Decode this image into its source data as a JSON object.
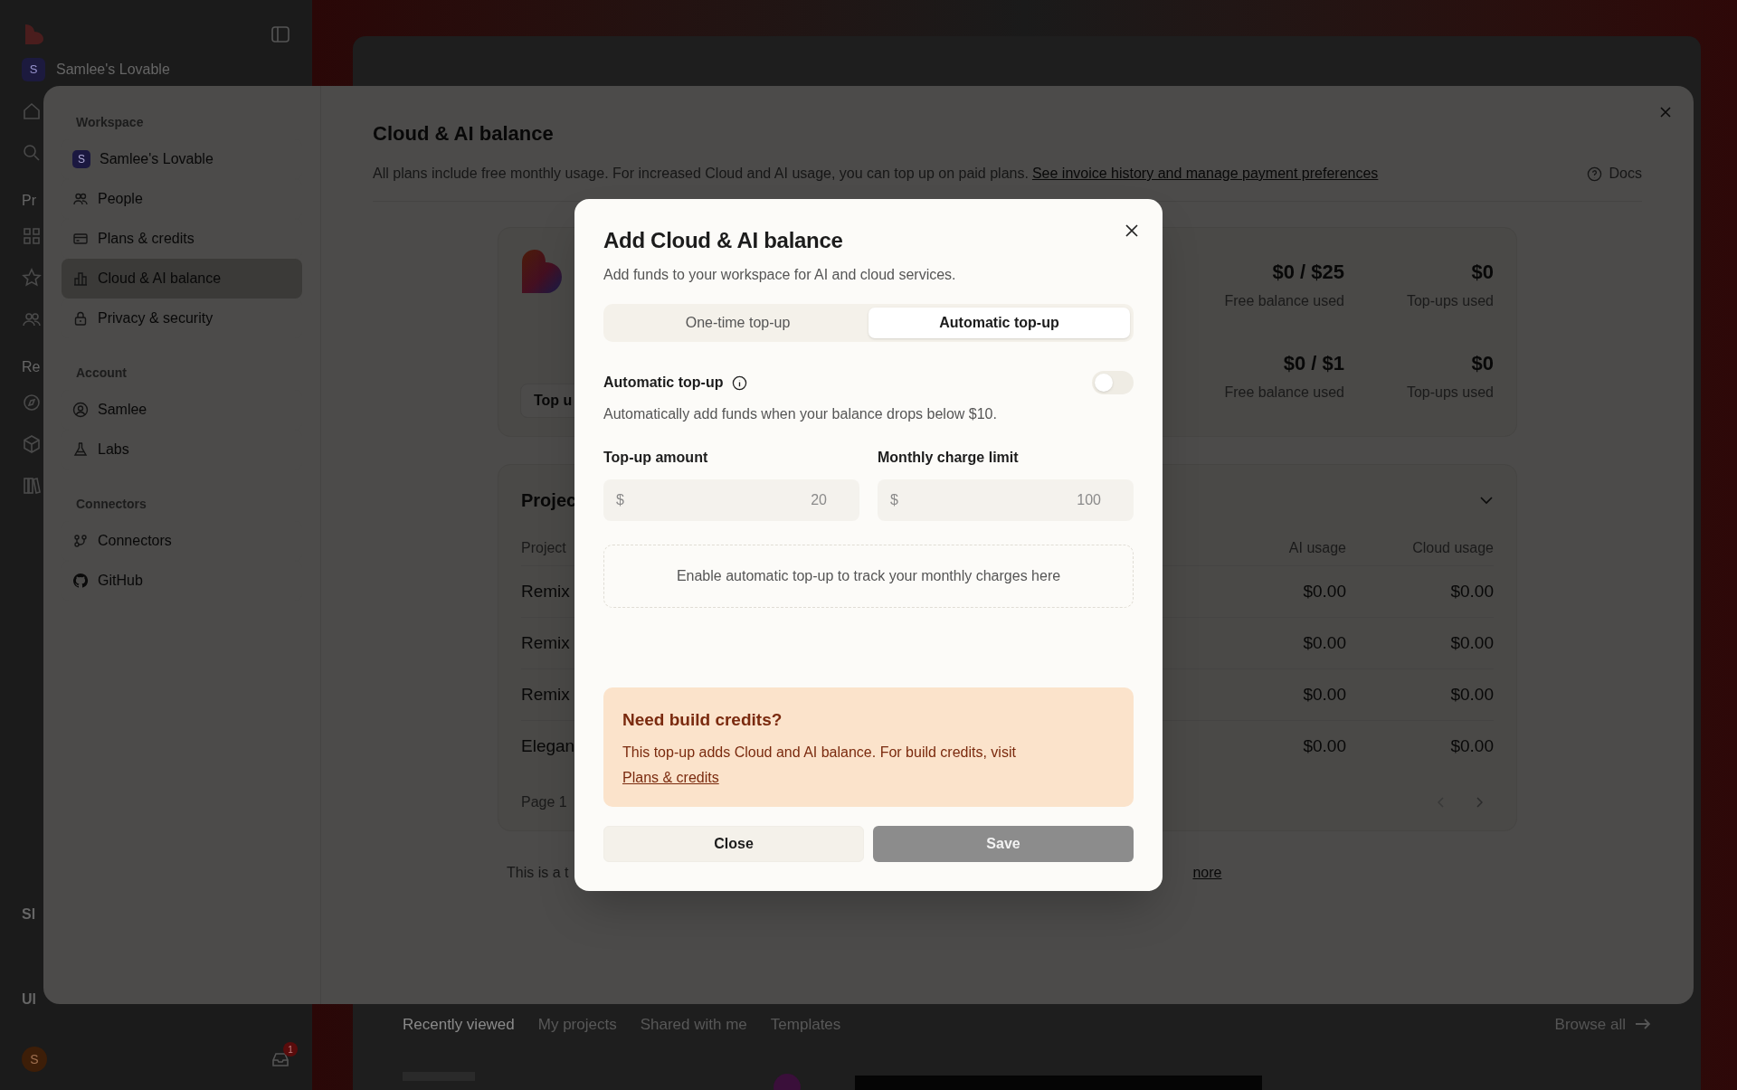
{
  "app": {
    "workspace": {
      "avatar": "S",
      "name": "Samlee's Lovable"
    },
    "nav_fragments": [
      "Pr",
      "Re"
    ],
    "footer_fragments": [
      "Sl",
      "Ul"
    ],
    "user_avatar": "S",
    "notification_count": "1",
    "tabs": [
      {
        "label": "Recently viewed",
        "selected": true
      },
      {
        "label": "My projects",
        "selected": false
      },
      {
        "label": "Shared with me",
        "selected": false
      },
      {
        "label": "Templates",
        "selected": false
      }
    ],
    "browse_all": "Browse all"
  },
  "settings": {
    "sidebar": [
      {
        "title": "Workspace",
        "items": [
          {
            "label": "Samlee's Lovable",
            "avatar": "S",
            "selected": false
          },
          {
            "label": "People",
            "selected": false
          },
          {
            "label": "Plans & credits",
            "selected": false
          },
          {
            "label": "Cloud & AI balance",
            "selected": true
          },
          {
            "label": "Privacy & security",
            "selected": false
          }
        ]
      },
      {
        "title": "Account",
        "items": [
          {
            "label": "Samlee",
            "selected": false
          },
          {
            "label": "Labs",
            "selected": false
          }
        ]
      },
      {
        "title": "Connectors",
        "items": [
          {
            "label": "Connectors",
            "selected": false
          },
          {
            "label": "GitHub",
            "selected": false
          }
        ]
      }
    ],
    "title": "Cloud & AI balance",
    "description": "All plans include free monthly usage. For increased Cloud and AI usage, you can top up on paid plans.",
    "description_link": "See invoice history and manage payment preferences",
    "docs": "Docs",
    "top_up_button": "Top u",
    "balance_rows": [
      {
        "amount": "$0 / $25",
        "amount_label": "Free balance used",
        "topups": "$0",
        "topups_label": "Top-ups used"
      },
      {
        "amount": "$0 / $1",
        "amount_label": "Free balance used",
        "topups": "$0",
        "topups_label": "Top-ups used"
      }
    ],
    "projects": {
      "title": "Projec",
      "columns": [
        "Project",
        "AI usage",
        "Cloud usage"
      ],
      "rows": [
        {
          "name": "Remix",
          "ai": "$0.00",
          "cloud": "$0.00"
        },
        {
          "name": "Remix",
          "ai": "$0.00",
          "cloud": "$0.00"
        },
        {
          "name": "Remix",
          "ai": "$0.00",
          "cloud": "$0.00"
        },
        {
          "name": "Elegan",
          "ai": "$0.00",
          "cloud": "$0.00"
        }
      ],
      "page": "Page 1"
    },
    "footer_text": "This is a t",
    "footer_link": "nore"
  },
  "modal": {
    "title": "Add Cloud & AI balance",
    "subtitle": "Add funds to your workspace for AI and cloud services.",
    "tabs": [
      {
        "label": "One-time top-up",
        "selected": false
      },
      {
        "label": "Automatic top-up",
        "selected": true
      }
    ],
    "auto_topup": {
      "label": "Automatic top-up",
      "on": false,
      "description": "Automatically add funds when your balance drops below $10."
    },
    "fields": [
      {
        "label": "Top-up amount",
        "prefix": "$",
        "value": "20"
      },
      {
        "label": "Monthly charge limit",
        "prefix": "$",
        "value": "100"
      }
    ],
    "empty_note": "Enable automatic top-up to track your monthly charges here",
    "callout": {
      "title": "Need build credits?",
      "text": "This top-up adds Cloud and AI balance. For build credits, visit",
      "link": "Plans & credits"
    },
    "buttons": [
      {
        "label": "Close",
        "kind": "secondary",
        "disabled": false
      },
      {
        "label": "Save",
        "kind": "primary",
        "disabled": true
      }
    ]
  }
}
